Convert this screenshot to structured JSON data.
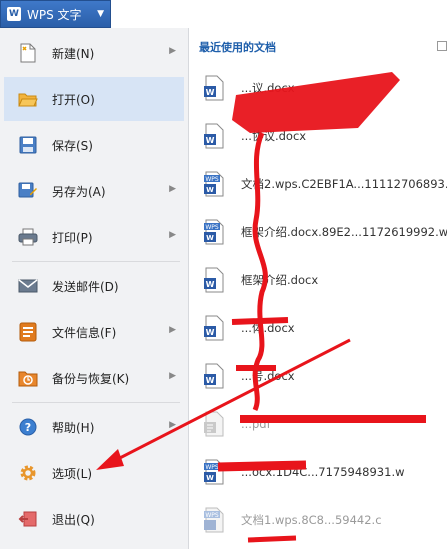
{
  "app": {
    "title": "WPS 文字",
    "logo_letter": "W"
  },
  "menu": {
    "items": [
      {
        "label": "新建(N)",
        "icon": "new-document-icon",
        "submenu": true
      },
      {
        "label": "打开(O)",
        "icon": "open-folder-icon",
        "submenu": false
      },
      {
        "label": "保存(S)",
        "icon": "save-icon",
        "submenu": false
      },
      {
        "label": "另存为(A)",
        "icon": "save-as-icon",
        "submenu": true
      },
      {
        "label": "打印(P)",
        "icon": "printer-icon",
        "submenu": true
      },
      {
        "label": "发送邮件(D)",
        "icon": "mail-icon",
        "submenu": false
      },
      {
        "label": "文件信息(F)",
        "icon": "file-info-icon",
        "submenu": true
      },
      {
        "label": "备份与恢复(K)",
        "icon": "backup-icon",
        "submenu": true
      },
      {
        "label": "帮助(H)",
        "icon": "help-icon",
        "submenu": true
      },
      {
        "label": "选项(L)",
        "icon": "gear-icon",
        "submenu": false
      },
      {
        "label": "退出(Q)",
        "icon": "exit-icon",
        "submenu": false
      }
    ],
    "highlighted": "打开(O)"
  },
  "recent": {
    "title": "最近使用的文档",
    "files": [
      {
        "name": "...议.docx",
        "type": "word"
      },
      {
        "name": "...协议.docx",
        "type": "word"
      },
      {
        "name": "文档2.wps.C2EBF1A...11112706893.",
        "type": "wps"
      },
      {
        "name": "框架介绍.docx.89E2...1172619992.w",
        "type": "wps"
      },
      {
        "name": "框架介绍.docx",
        "type": "word"
      },
      {
        "name": "...体.docx",
        "type": "word"
      },
      {
        "name": "...号.docx",
        "type": "word"
      },
      {
        "name": "...pdf",
        "type": "pdf"
      },
      {
        "name": "...ocx.1D4C...7175948931.w",
        "type": "wps"
      },
      {
        "name": "文档1.wps.8C8...59442.c",
        "type": "wps"
      }
    ]
  },
  "colors": {
    "accent": "#2a5fa9",
    "highlight": "#d7e4f5",
    "annotation": "#e8141b"
  }
}
